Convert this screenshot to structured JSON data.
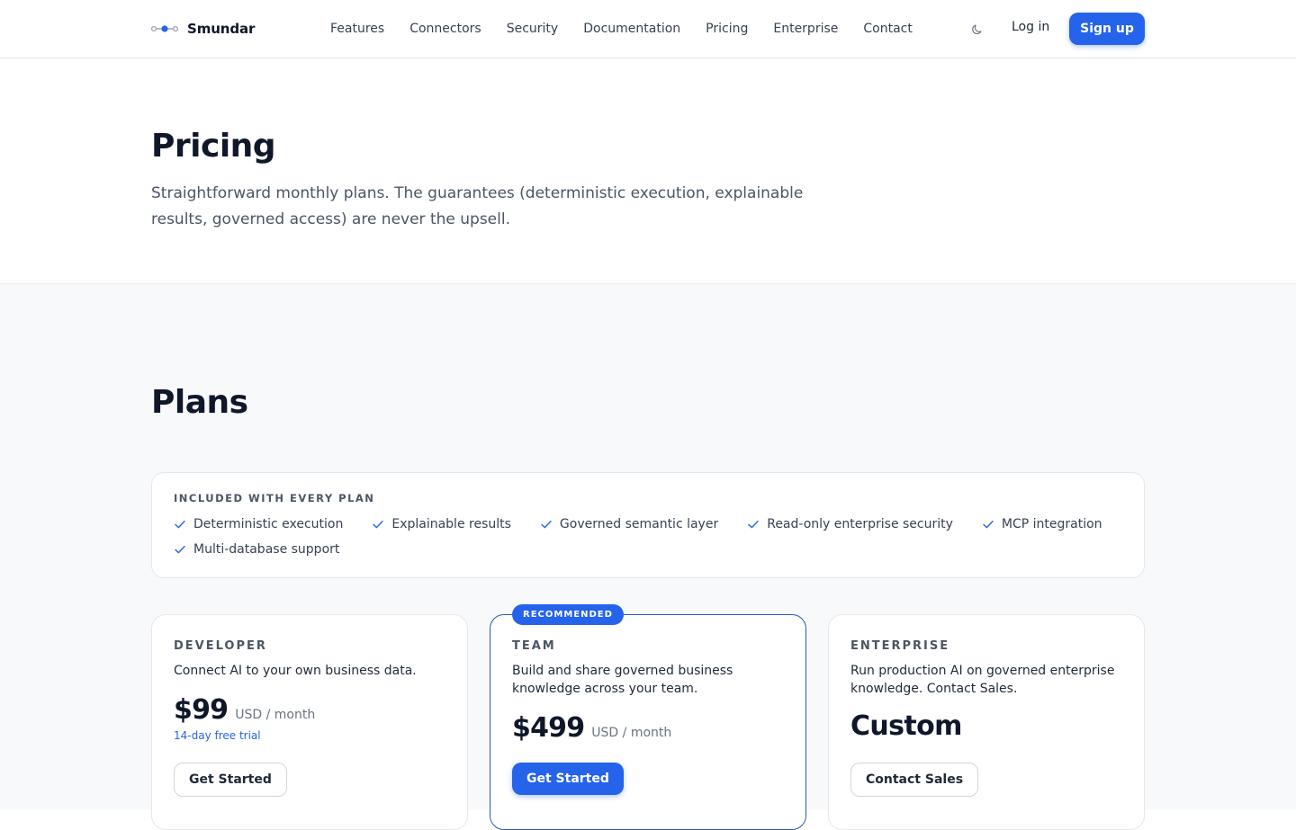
{
  "header": {
    "brand": "Smundar",
    "nav": [
      "Features",
      "Connectors",
      "Security",
      "Documentation",
      "Pricing",
      "Enterprise",
      "Contact"
    ],
    "theme_toggle_icon": "moon-icon",
    "login_label": "Log in",
    "signup_label": "Sign up"
  },
  "hero": {
    "title": "Pricing",
    "subtitle": "Straightforward monthly plans. The guarantees (deterministic execution, explainable results, governed access) are never the upsell."
  },
  "plans": {
    "title": "Plans",
    "included": {
      "label": "INCLUDED WITH EVERY PLAN",
      "items": [
        "Deterministic execution",
        "Explainable results",
        "Governed semantic layer",
        "Read-only enterprise security",
        "MCP integration",
        "Multi-database support"
      ]
    },
    "cards": [
      {
        "name": "DEVELOPER",
        "description": "Connect AI to your own business data.",
        "price": "$99",
        "unit": "USD / month",
        "trial": "14-day free trial",
        "cta": "Get Started"
      },
      {
        "badge": "RECOMMENDED",
        "name": "TEAM",
        "description": "Build and share governed business knowledge across your team.",
        "price": "$499",
        "unit": "USD / month",
        "cta": "Get Started"
      },
      {
        "name": "ENTERPRISE",
        "description": "Run production AI on governed enterprise knowledge. Contact Sales.",
        "price": "Custom",
        "cta": "Contact Sales"
      }
    ]
  },
  "colors": {
    "accent": "#2563eb",
    "text": "#0f172a",
    "muted": "#4b5563",
    "section_bg": "#f8f9fb"
  }
}
